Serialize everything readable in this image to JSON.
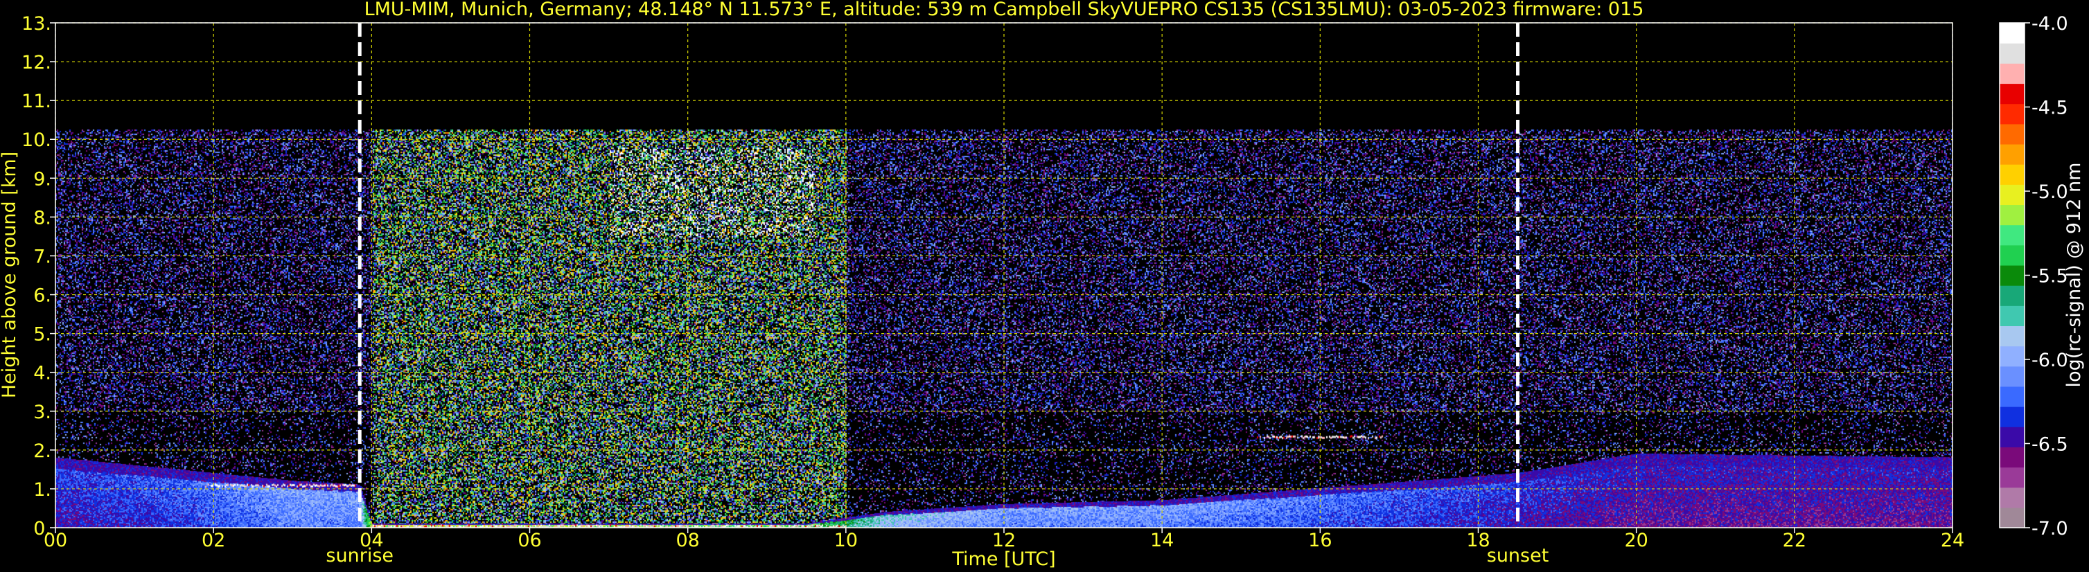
{
  "chart_data": {
    "type": "heatmap",
    "title": "LMU-MIM, Munich, Germany; 48.148° N 11.573° E, altitude: 539 m    Campbell SkyVUEPRO CS135 (CS135LMU): 03-05-2023    firmware: 015",
    "xlabel": "Time [UTC]",
    "ylabel": "Height above ground [km]",
    "xlim": [
      0,
      24
    ],
    "ylim": [
      0,
      13
    ],
    "x_ticks": [
      "00",
      "02",
      "04",
      "06",
      "08",
      "10",
      "12",
      "14",
      "16",
      "18",
      "20",
      "22",
      "24"
    ],
    "y_ticks": [
      "0.",
      "1.",
      "2.",
      "3.",
      "4.",
      "5.",
      "6.",
      "7.",
      "8.",
      "9.",
      "10.",
      "11.",
      "12.",
      "13."
    ],
    "grid": true,
    "markers": [
      {
        "label": "sunrise",
        "x": 3.85
      },
      {
        "label": "sunset",
        "x": 18.5
      }
    ],
    "colorbar": {
      "label": "log(rc-signal) @ 912 nm",
      "ticks": [
        "-4.0",
        "-4.5",
        "-5.0",
        "-5.5",
        "-6.0",
        "-6.5",
        "-7.0"
      ],
      "range": [
        -7.0,
        -4.0
      ],
      "colors": [
        "#a08898",
        "#b07aa8",
        "#9a3a98",
        "#7a0a7a",
        "#3a0aa8",
        "#1030e0",
        "#3a6aff",
        "#6a90ff",
        "#90b0ff",
        "#a8c8f0",
        "#40c8b0",
        "#18a878",
        "#0a8a0a",
        "#20d050",
        "#40e880",
        "#a0f040",
        "#e8f020",
        "#ffd000",
        "#ffa000",
        "#ff6a00",
        "#ff2a00",
        "#e80000",
        "#ffb0b0",
        "#e0e0e0",
        "#ffffff"
      ]
    },
    "signal_top_km": 10.25,
    "boundary_layer": [
      {
        "x": 0,
        "top": 1.8,
        "core": -6.3
      },
      {
        "x": 1.5,
        "top": 1.5,
        "core": -6.2
      },
      {
        "x": 3.0,
        "top": 1.2,
        "core": -6.0
      },
      {
        "x": 3.85,
        "top": 1.1,
        "core": -6.0
      },
      {
        "x": 4.0,
        "top": 0.1,
        "core": -5.0
      },
      {
        "x": 9.5,
        "top": 0.1,
        "core": -5.2
      },
      {
        "x": 10.5,
        "top": 0.4,
        "core": -5.8
      },
      {
        "x": 12.0,
        "top": 0.6,
        "core": -6.0
      },
      {
        "x": 14.0,
        "top": 0.7,
        "core": -6.0
      },
      {
        "x": 18.5,
        "top": 1.4,
        "core": -6.3
      },
      {
        "x": 20.0,
        "top": 1.9,
        "core": -6.4
      },
      {
        "x": 24.0,
        "top": 1.8,
        "core": -6.4
      }
    ],
    "cloud_layers": [
      {
        "x": [
          1.9,
          3.8
        ],
        "height": 1.1,
        "value": -4.0
      },
      {
        "x": [
          15.2,
          16.8
        ],
        "height": 2.35,
        "value": -4.0
      },
      {
        "x": [
          4.0,
          10.0
        ],
        "height": 0.05,
        "value": -4.0
      }
    ],
    "noisy_region": {
      "x": [
        4.0,
        10.0
      ],
      "peak": [
        7.5,
        9.8
      ]
    }
  }
}
